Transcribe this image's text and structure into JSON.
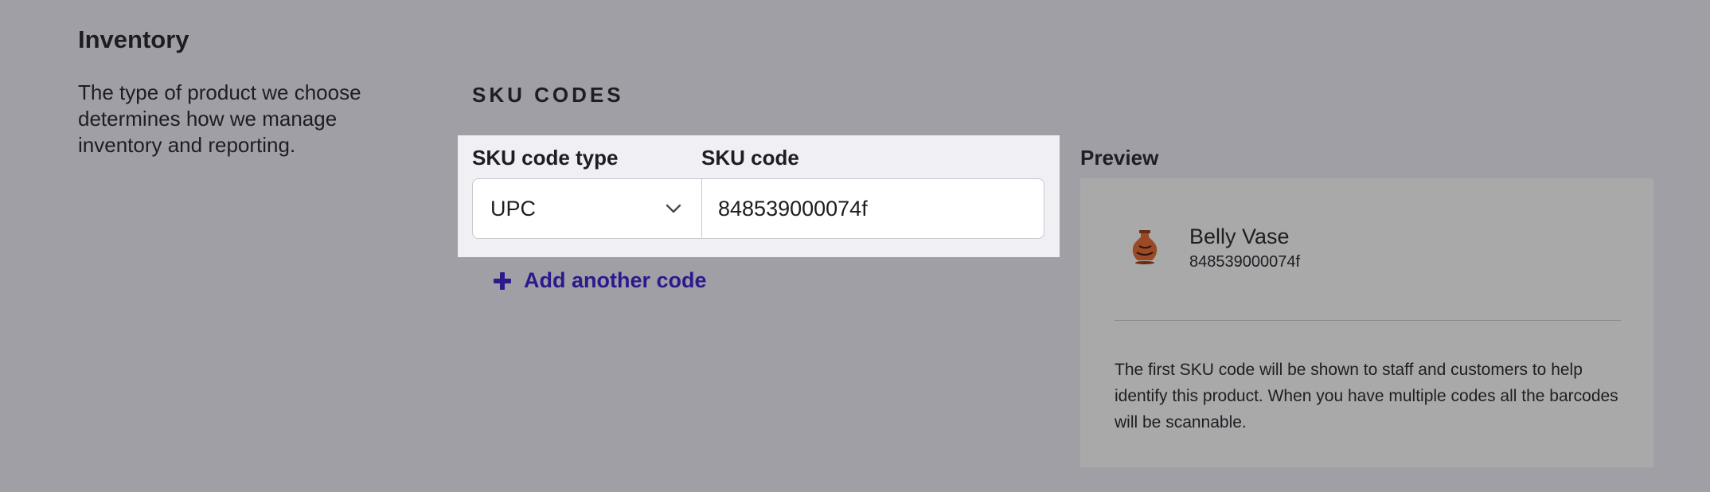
{
  "inventory": {
    "title": "Inventory",
    "description": "The type of product we choose determines how we manage inventory and reporting."
  },
  "sku": {
    "heading": "SKU CODES",
    "type_label": "SKU code type",
    "code_label": "SKU code",
    "type_value": "UPC",
    "code_value": "848539000074f",
    "add_label": "Add another code"
  },
  "preview": {
    "label": "Preview",
    "product_name": "Belly Vase",
    "product_code": "848539000074f",
    "help_text": "The first SKU code will be shown to staff and customers to help identify this product. When you have multiple codes all the barcodes will be scannable."
  },
  "colors": {
    "background": "#a19fa6",
    "panel": "#efeff4",
    "accent": "#2a1a8c",
    "preview_card": "#a9a9a9"
  },
  "icons": {
    "select_chevron": "chevron-down-icon",
    "add": "plus-icon",
    "product_thumb": "vase-image"
  }
}
